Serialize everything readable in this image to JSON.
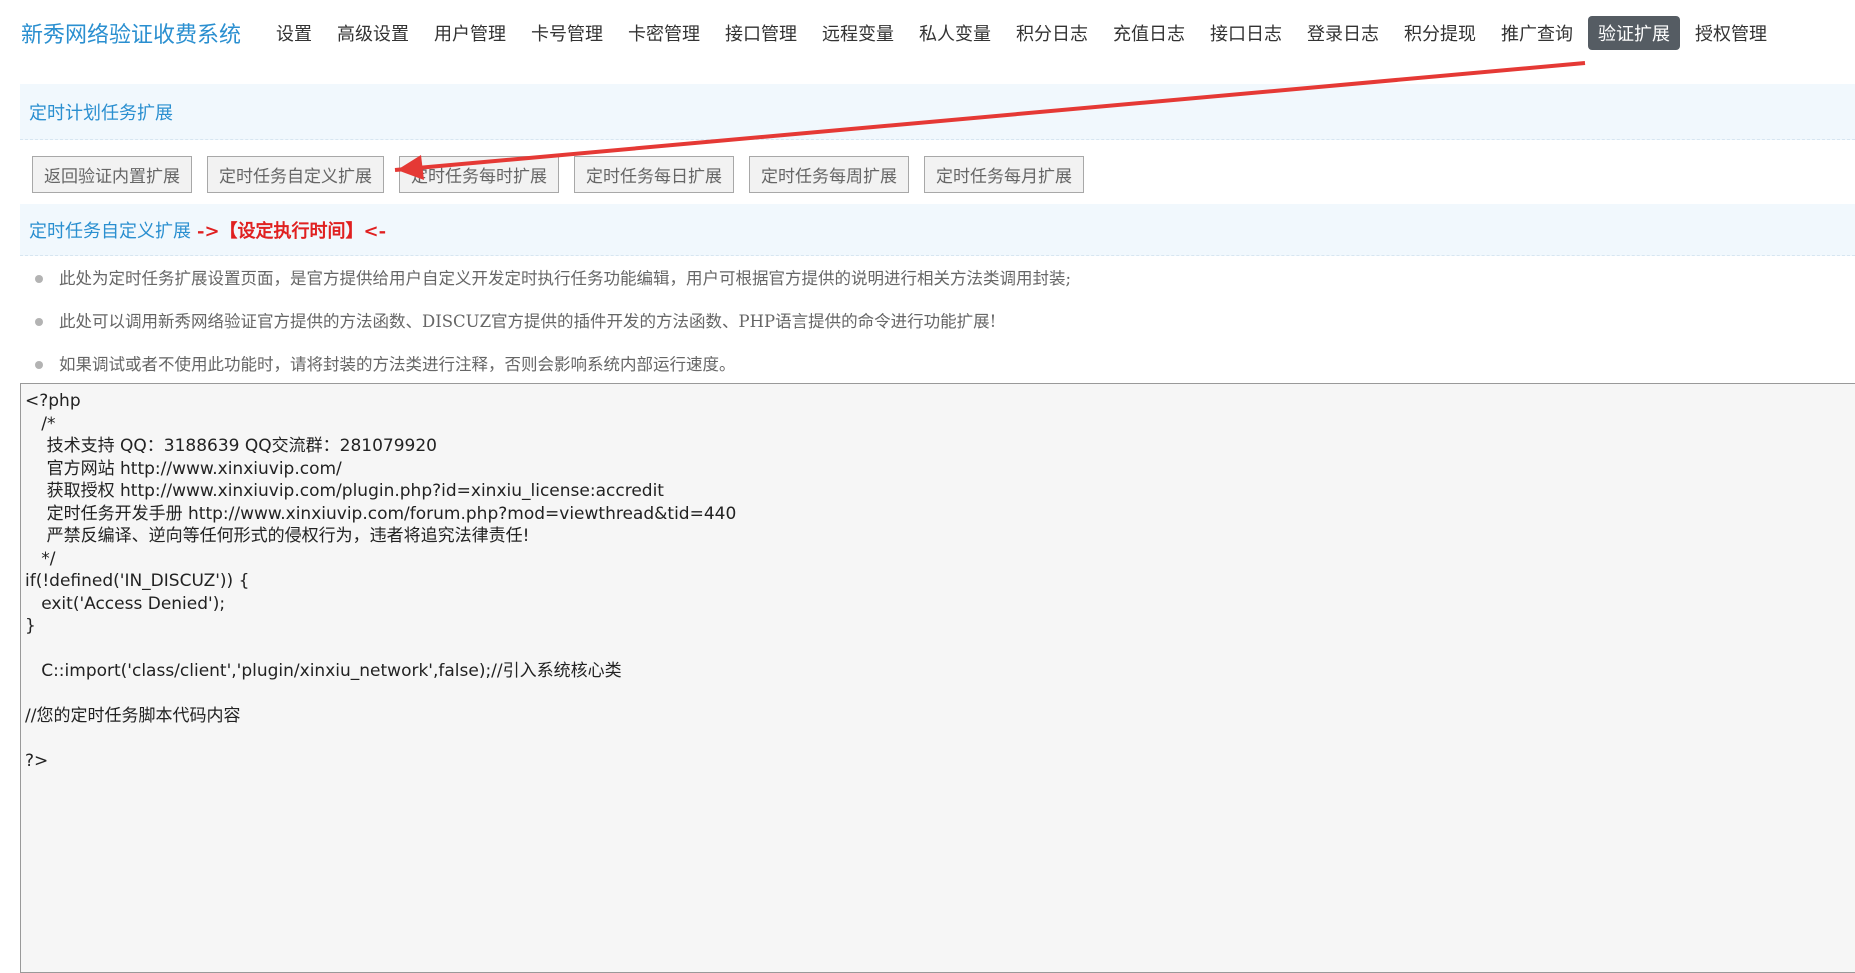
{
  "brand": "新秀网络验证收费系统",
  "nav": [
    "设置",
    "高级设置",
    "用户管理",
    "卡号管理",
    "卡密管理",
    "接口管理",
    "远程变量",
    "私人变量",
    "积分日志",
    "充值日志",
    "接口日志",
    "登录日志",
    "积分提现",
    "推广查询",
    "验证扩展",
    "授权管理"
  ],
  "nav_active": "验证扩展",
  "section_title": "定时计划任务扩展",
  "tabs": [
    "返回验证内置扩展",
    "定时任务自定义扩展",
    "定时任务每时扩展",
    "定时任务每日扩展",
    "定时任务每周扩展",
    "定时任务每月扩展"
  ],
  "subsection": {
    "title": "定时任务自定义扩展",
    "accent": "->【设定执行时间】<-"
  },
  "notes": [
    "此处为定时任务扩展设置页面，是官方提供给用户自定义开发定时执行任务功能编辑，用户可根据官方提供的说明进行相关方法类调用封装;",
    "此处可以调用新秀网络验证官方提供的方法函数、DISCUZ官方提供的插件开发的方法函数、PHP语言提供的命令进行功能扩展!",
    "如果调试或者不使用此功能时，请将封装的方法类进行注释，否则会影响系统内部运行速度。"
  ],
  "code": "<?php\n   /*\n    技术支持 QQ：3188639 QQ交流群：281079920\n    官方网站 http://www.xinxiuvip.com/\n    获取授权 http://www.xinxiuvip.com/plugin.php?id=xinxiu_license:accredit\n    定时任务开发手册 http://www.xinxiuvip.com/forum.php?mod=viewthread&tid=440\n    严禁反编译、逆向等任何形式的侵权行为，违者将追究法律责任!\n   */\nif(!defined('IN_DISCUZ')) {\n   exit('Access Denied');\n}\n\n   C::import('class/client','plugin/xinxiu_network',false);//引入系统核心类\n\n//您的定时任务脚本代码内容\n\n?>",
  "colors": {
    "brand": "#2a8fd0",
    "active_tab_bg": "#555c63",
    "section_bg": "#f1f8fd",
    "accent_red": "#e02020",
    "annotation_arrow": "#e53935"
  }
}
